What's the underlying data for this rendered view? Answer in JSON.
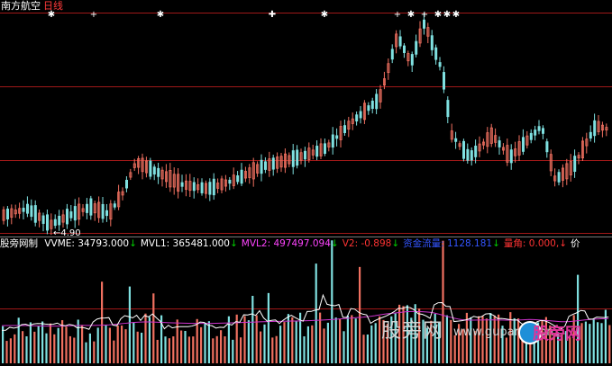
{
  "title": {
    "stock_name": "南方航空",
    "period": "日线"
  },
  "min_price_label": "4.90",
  "indicator_bar": {
    "name": "股旁网制",
    "items": [
      {
        "label": "VVME: 34793.000",
        "arrow": "↓",
        "color": "#ffffff",
        "arrow_color": "#00cc00"
      },
      {
        "label": "MVL1: 365481.000",
        "arrow": "↓",
        "color": "#ffffff",
        "arrow_color": "#00cc00"
      },
      {
        "label": "MVL2: 497497.094",
        "arrow": "↓",
        "color": "#ff44ff",
        "arrow_color": "#00cc00"
      },
      {
        "label": "V2: -0.898",
        "arrow": "↓",
        "color": "#ff3333",
        "arrow_color": "#00cc00"
      },
      {
        "label": "资金流量: 1128.181",
        "arrow": "↓",
        "color": "#3355ff",
        "arrow_color": "#00cc00"
      },
      {
        "label": "量角: 0.000,",
        "arrow": "↓",
        "color": "#ff3333",
        "arrow_color": "#ff3333"
      },
      {
        "label": "价",
        "arrow": "",
        "color": "#ffffff",
        "arrow_color": "#ffffff"
      }
    ]
  },
  "watermark": {
    "text": "股旁网",
    "url": "www.gupang.com",
    "logo_text": "股旁网"
  },
  "colors": {
    "up": "#f07060",
    "down": "#7fe0e0",
    "grid": "#a01818",
    "ma1": "#ffffff",
    "ma2": "#cc33cc"
  },
  "marker_icon": "asterisk-icon"
}
